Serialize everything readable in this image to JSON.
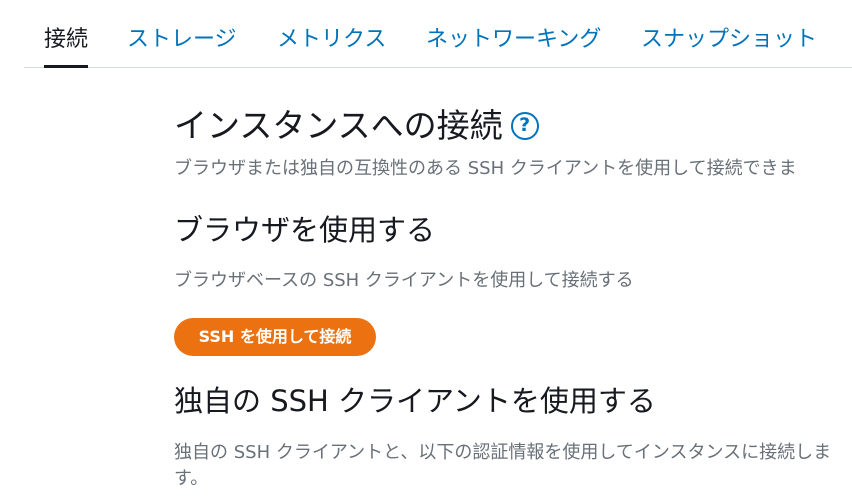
{
  "tabs": [
    {
      "label": "接続",
      "active": true
    },
    {
      "label": "ストレージ",
      "active": false
    },
    {
      "label": "メトリクス",
      "active": false
    },
    {
      "label": "ネットワーキング",
      "active": false
    },
    {
      "label": "スナップショット",
      "active": false
    }
  ],
  "main": {
    "title": "インスタンスへの接続",
    "help_icon_glyph": "?",
    "subtitle": "ブラウザまたは独自の互換性のある SSH クライアントを使用して接続できま",
    "browser_section": {
      "heading": "ブラウザを使用する",
      "description": "ブラウザベースの SSH クライアントを使用して接続する",
      "button_label": "SSH を使用して接続"
    },
    "own_client_section": {
      "heading": "独自の SSH クライアントを使用する",
      "description": "独自の SSH クライアントと、以下の認証情報を使用してインスタンスに接続しま す。"
    }
  },
  "colors": {
    "link": "#0073bb",
    "text": "#16191f",
    "secondary_text": "#687078",
    "primary_button": "#ec7211",
    "divider": "#d5dbdb"
  },
  "icons": [
    "help-icon"
  ]
}
